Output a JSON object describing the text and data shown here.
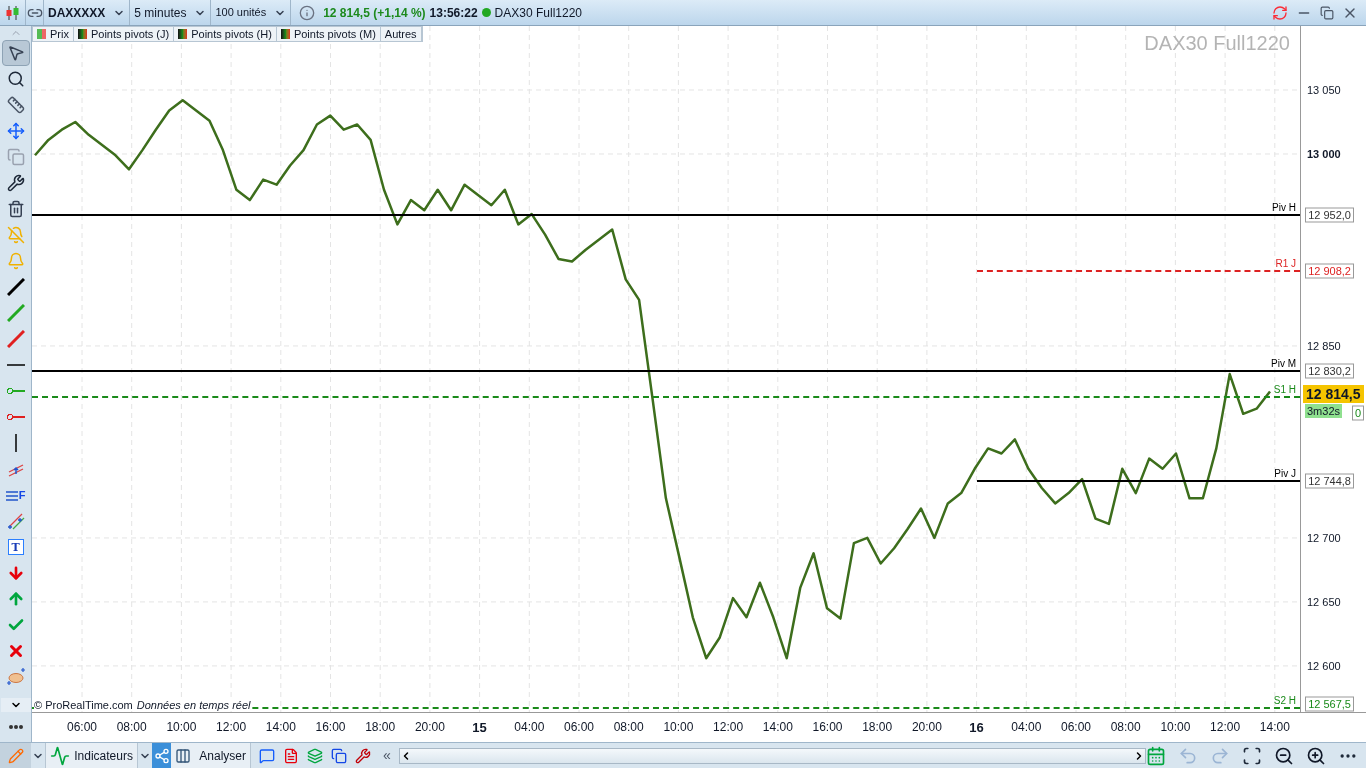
{
  "toolbar": {
    "period": "5 minutes",
    "units": "100 unités",
    "price": "12 814,5 (+1,14 %)",
    "time": "13:56:22",
    "connected": true,
    "feed": "DAX30 Full1220"
  },
  "tools": [
    {
      "kind": "pointer",
      "selected": true
    },
    {
      "kind": "zoom",
      "selected": false
    },
    {
      "kind": "ruler",
      "selected": false
    },
    {
      "kind": "move",
      "selected": false
    },
    {
      "kind": "copy",
      "selected": false
    },
    {
      "kind": "wrench",
      "selected": false
    },
    {
      "kind": "trash",
      "selected": false
    },
    {
      "kind": "alert-off",
      "selected": false
    },
    {
      "kind": "alert",
      "selected": false
    },
    {
      "kind": "line",
      "color": "#000000",
      "selected": false
    },
    {
      "kind": "line",
      "color": "#22aa22",
      "selected": false
    },
    {
      "kind": "line",
      "color": "#e02020",
      "selected": false
    },
    {
      "kind": "hline",
      "selected": false
    },
    {
      "kind": "ray",
      "color": "#22aa22",
      "selected": false
    },
    {
      "kind": "ray",
      "color": "#e02020",
      "selected": false
    },
    {
      "kind": "vline",
      "selected": false
    },
    {
      "kind": "channel",
      "selected": false
    },
    {
      "kind": "fibonacci",
      "label": "F",
      "selected": false
    },
    {
      "kind": "parallel",
      "selected": false
    },
    {
      "kind": "text",
      "label": "T",
      "selected": false
    },
    {
      "kind": "arrow-down",
      "selected": false
    },
    {
      "kind": "arrow-up",
      "selected": false
    },
    {
      "kind": "check",
      "selected": false
    },
    {
      "kind": "cross",
      "selected": false
    },
    {
      "kind": "ellipse",
      "selected": false
    }
  ],
  "chart": {
    "legend": [
      {
        "label": "Prix",
        "kind": "price"
      },
      {
        "label": "Points pivots (J)",
        "kind": "pivot"
      },
      {
        "label": "Points pivots (H)",
        "kind": "pivot"
      },
      {
        "label": "Points pivots (M)",
        "kind": "pivot"
      },
      {
        "label": "Autres",
        "kind": "more"
      }
    ],
    "watermark": "DAX30 Full1220",
    "copyright": "© ProRealTime.com",
    "data_note": "Données en temps réel",
    "current_price": "12 814,5",
    "countdown": "3m32s",
    "time_axis": [
      {
        "label": "06:00",
        "kind": "time"
      },
      {
        "label": "08:00",
        "kind": "time"
      },
      {
        "label": "10:00",
        "kind": "time"
      },
      {
        "label": "12:00",
        "kind": "time"
      },
      {
        "label": "14:00",
        "kind": "time"
      },
      {
        "label": "16:00",
        "kind": "time"
      },
      {
        "label": "18:00",
        "kind": "time"
      },
      {
        "label": "20:00",
        "kind": "time"
      },
      {
        "label": "15",
        "kind": "day"
      },
      {
        "label": "04:00",
        "kind": "time"
      },
      {
        "label": "06:00",
        "kind": "time"
      },
      {
        "label": "08:00",
        "kind": "time"
      },
      {
        "label": "10:00",
        "kind": "time"
      },
      {
        "label": "12:00",
        "kind": "time"
      },
      {
        "label": "14:00",
        "kind": "time"
      },
      {
        "label": "16:00",
        "kind": "time"
      },
      {
        "label": "18:00",
        "kind": "time"
      },
      {
        "label": "20:00",
        "kind": "time"
      },
      {
        "label": "16",
        "kind": "day"
      },
      {
        "label": "04:00",
        "kind": "time"
      },
      {
        "label": "06:00",
        "kind": "time"
      },
      {
        "label": "08:00",
        "kind": "time"
      },
      {
        "label": "10:00",
        "kind": "time"
      },
      {
        "label": "12:00",
        "kind": "time"
      },
      {
        "label": "14:00",
        "kind": "time"
      }
    ],
    "level_tags": [
      "12 952,0",
      "12 908,2",
      "12 830,2",
      "0",
      "12 744,8",
      "12 567,5"
    ],
    "level_lines": [
      {
        "dashed": false,
        "current_day_only": false
      },
      {
        "dashed": true,
        "current_day_only": true
      },
      {
        "dashed": false,
        "current_day_only": false
      },
      {
        "dashed": true,
        "current_day_only": false
      },
      {
        "dashed": false,
        "current_day_only": true
      },
      {
        "dashed": true,
        "current_day_only": false
      }
    ],
    "chart_data": {
      "type": "line",
      "grid": true,
      "ylim": [
        12564,
        13100
      ],
      "yticks": [
        {
          "value": 13050,
          "label": "13 050"
        },
        {
          "value": 13000,
          "label": "13 000"
        },
        {
          "value": 12850,
          "label": "12 850"
        },
        {
          "value": 12700,
          "label": "12 700"
        },
        {
          "value": 12650,
          "label": "12 650"
        },
        {
          "value": 12600,
          "label": "12 600"
        }
      ],
      "categories": [
        null,
        null,
        null,
        null,
        null,
        null,
        null,
        null,
        null,
        null,
        null,
        null,
        null,
        null,
        null,
        null,
        null,
        null,
        null,
        null,
        null,
        null,
        null,
        null,
        null,
        null,
        null,
        null,
        null,
        null,
        null,
        null,
        null,
        null,
        null,
        null,
        null,
        null,
        null,
        null,
        null,
        null,
        null,
        null,
        null,
        null,
        null,
        null,
        null,
        null,
        null,
        null,
        null,
        null,
        null,
        null,
        null,
        null,
        null,
        null,
        null,
        null,
        null,
        null,
        null,
        null,
        null,
        null,
        null,
        null,
        null,
        null,
        null,
        null,
        null,
        null,
        null,
        null,
        null,
        null,
        null,
        null,
        null,
        null,
        null,
        null,
        null,
        null,
        null,
        null,
        null,
        null,
        null
      ],
      "series": [
        {
          "name": "DAXXXXX",
          "color": "#3d6e1c",
          "values": [
            12999,
            13011,
            13019,
            13025,
            13015,
            13007,
            12999,
            12988,
            13003,
            13019,
            13034,
            13042,
            13034,
            13026,
            13003,
            12972,
            12964,
            12980,
            12976,
            12991,
            13003,
            13023,
            13030,
            13019,
            13023,
            13011,
            12972,
            12945,
            12964,
            12956,
            12972,
            12956,
            12976,
            12968,
            12960,
            12972,
            12945,
            12953,
            12937,
            12918,
            12916,
            12925,
            12933,
            12941,
            12902,
            12886,
            12809,
            12731,
            12685,
            12638,
            12606,
            12622,
            12653,
            12638,
            12665,
            12638,
            12606,
            12661,
            12688,
            12645,
            12637,
            12696,
            12700,
            12680,
            12692,
            12707,
            12723,
            12700,
            12727,
            12735,
            12754,
            12770,
            12766,
            12777,
            12754,
            12739,
            12727,
            12735,
            12746,
            12715,
            12711,
            12754,
            12735,
            12762,
            12754,
            12766,
            12731,
            12731,
            12770,
            12828,
            12797,
            12801,
            12814.5
          ]
        }
      ],
      "ref_lines": [
        {
          "axis": "y",
          "value": 12952,
          "label": "Piv H",
          "color": "#000000"
        },
        {
          "axis": "y",
          "value": 12908.2,
          "label": "R1 J",
          "color": "#dd2222"
        },
        {
          "axis": "y",
          "value": 12830.2,
          "label": "Piv M",
          "color": "#000000"
        },
        {
          "axis": "y",
          "value": 12810,
          "label": "S1 H",
          "color": "#1a8a1a"
        },
        {
          "axis": "y",
          "value": 12744.8,
          "label": "Piv J",
          "color": "#000000"
        },
        {
          "axis": "y",
          "value": 12567.5,
          "label": "S2 H",
          "color": "#1a8a1a"
        }
      ]
    }
  },
  "bottom_bar": {
    "indicators": "Indicateurs",
    "analyse": "Analyser",
    "collapse": "«",
    "undo_enabled": false,
    "redo_enabled": false
  }
}
